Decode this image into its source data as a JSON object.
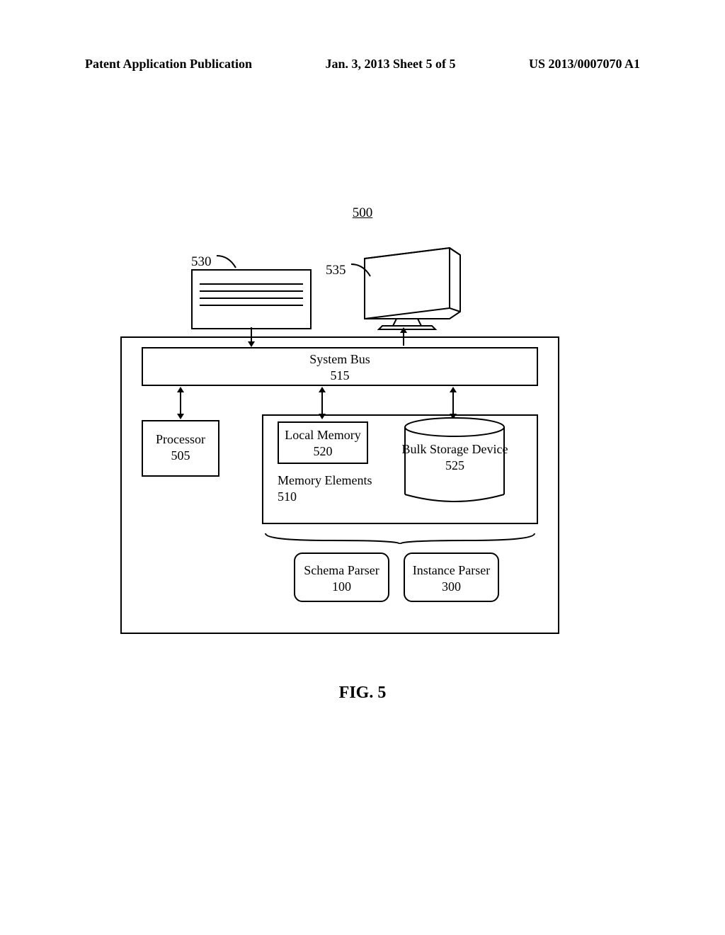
{
  "header": {
    "left": "Patent Application Publication",
    "center": "Jan. 3, 2013  Sheet 5 of 5",
    "right": "US 2013/0007070 A1"
  },
  "diagram": {
    "ref_num": "500",
    "label_530": "530",
    "label_535": "535",
    "system_bus": {
      "title": "System Bus",
      "num": "515"
    },
    "processor": {
      "title": "Processor",
      "num": "505"
    },
    "local_memory": {
      "title": "Local Memory",
      "num": "520"
    },
    "memory_elements": {
      "title": "Memory Elements",
      "num": "510"
    },
    "bulk_storage": {
      "title": "Bulk Storage Device",
      "num": "525"
    },
    "schema_parser": {
      "title": "Schema Parser",
      "num": "100"
    },
    "instance_parser": {
      "title": "Instance Parser",
      "num": "300"
    }
  },
  "figure_caption": "FIG. 5"
}
